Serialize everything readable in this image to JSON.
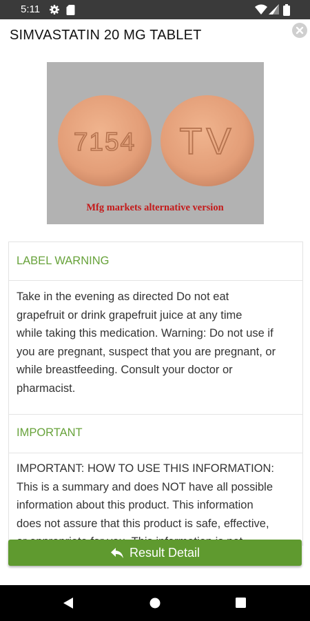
{
  "status_bar": {
    "time": "5:11",
    "icons": [
      "gear-icon",
      "sd-card-icon",
      "wifi-icon",
      "signal-icon",
      "battery-icon"
    ]
  },
  "header": {
    "title": "SIMVASTATIN 20 MG TABLET",
    "close_icon": "close-icon"
  },
  "pill_image": {
    "imprint_front": "7154",
    "imprint_back": "TV",
    "caption": "Mfg markets alternative version"
  },
  "sections": [
    {
      "title": "LABEL WARNING",
      "lines": [
        "Take in the evening as directed Do not eat",
        "grapefruit or drink grapefruit juice at any time",
        "while taking this medication. Warning: Do not use if",
        "you are pregnant, suspect that you are pregnant, or",
        "while breastfeeding. Consult your doctor or",
        "pharmacist."
      ]
    },
    {
      "title": "IMPORTANT",
      "lines": [
        "IMPORTANT: HOW TO USE THIS INFORMATION:",
        "This is a summary and does NOT have all possible",
        "information about this product. This information",
        "does not assure that this product is safe, effective,",
        "or appropriate for you. This information is not"
      ]
    }
  ],
  "result_button": {
    "label": "Result Detail",
    "icon": "reply-arrow-icon"
  },
  "nav_bar": {
    "icons": [
      "back-icon",
      "home-icon",
      "recents-icon"
    ]
  },
  "colors": {
    "accent_green": "#67a23a",
    "button_green": "#5f9a2f",
    "status_bar": "#3a3a3a",
    "pill": "#e3a07b"
  }
}
